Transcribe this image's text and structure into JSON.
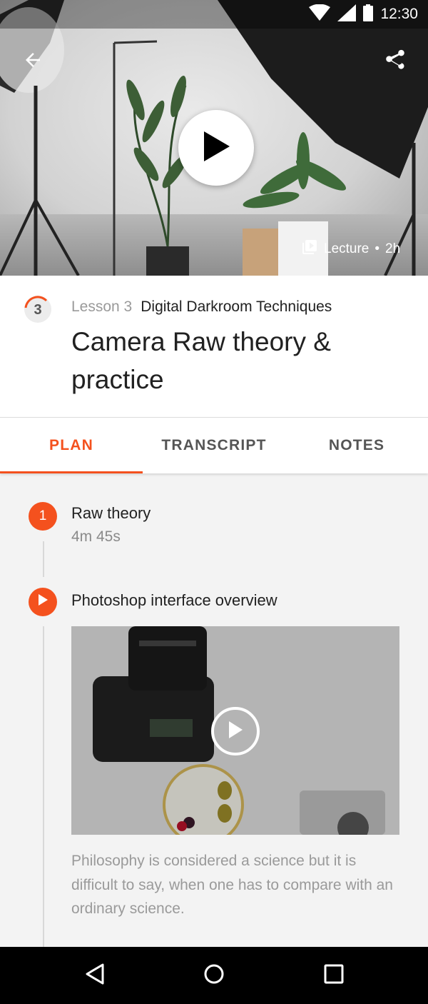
{
  "status_bar": {
    "time": "12:30"
  },
  "hero": {
    "lecture_type": "Lecture",
    "separator": "•",
    "duration": "2h"
  },
  "lesson": {
    "badge_number": "3",
    "number_label": "Lesson 3",
    "course_name": "Digital Darkroom Techniques",
    "title": "Camera Raw theory & practice"
  },
  "tabs": [
    {
      "label": "PLAN",
      "active": true
    },
    {
      "label": "TRANSCRIPT",
      "active": false
    },
    {
      "label": "NOTES",
      "active": false
    }
  ],
  "plan": {
    "steps": [
      {
        "number": "1",
        "title": "Raw theory",
        "duration": "4m 45s"
      },
      {
        "title": "Photoshop interface overview",
        "description": "Philosophy is considered a science but it is difficult to say, when one has to compare with an ordinary science."
      }
    ]
  },
  "colors": {
    "accent": "#f4511e",
    "nav_bar": "#000000",
    "text_primary": "#212121",
    "text_secondary": "#9a9a9a"
  },
  "icons": [
    "back-arrow-icon",
    "share-icon",
    "play-icon",
    "lecture-video-icon",
    "wifi-icon",
    "signal-icon",
    "battery-icon",
    "nav-back-icon",
    "nav-home-icon",
    "nav-recents-icon"
  ]
}
